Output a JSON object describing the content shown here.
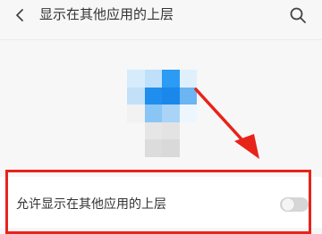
{
  "header": {
    "back_icon": "chevron-left-icon",
    "title": "显示在其他应用的上层",
    "search_icon": "search-icon"
  },
  "app_icon": {
    "style": "pixelated",
    "colors": {
      "light_blue": "#d6ecfc",
      "blue": "#6ab5f2",
      "deep_blue": "#1f8eee",
      "bright_blue": "#2b9bf3",
      "pale_blue": "#c3e0f9",
      "light_gray": "#e6e6e6",
      "gray": "#dcdcdc"
    }
  },
  "annotation": {
    "arrow_color": "#e8231a",
    "highlight_color": "#e8231a"
  },
  "setting": {
    "label": "允许显示在其他应用的上层",
    "toggle_on": false
  }
}
